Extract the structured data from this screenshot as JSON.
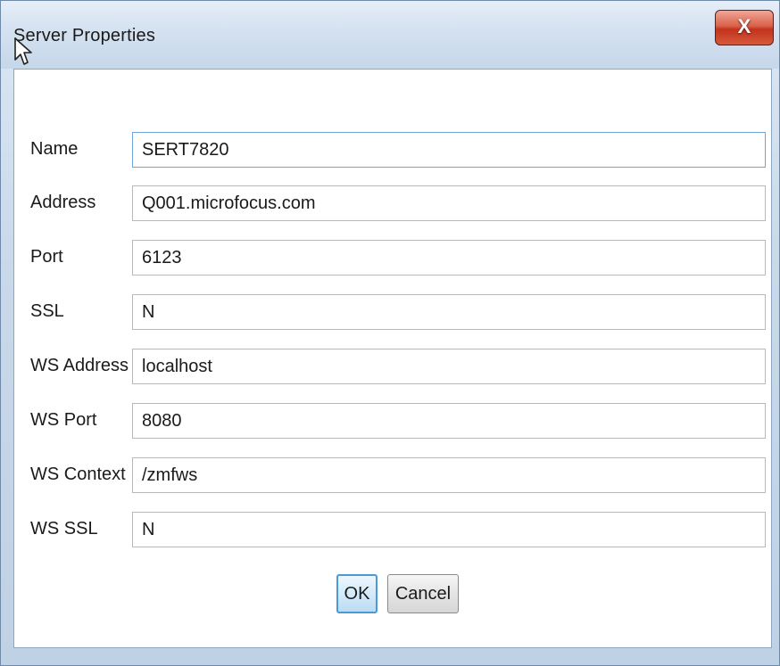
{
  "window": {
    "title": "Server Properties",
    "close_label": "X"
  },
  "form": {
    "fields": [
      {
        "label": "Name",
        "value": "SERT7820"
      },
      {
        "label": "Address",
        "value": "Q001.microfocus.com"
      },
      {
        "label": "Port",
        "value": "6123"
      },
      {
        "label": "SSL",
        "value": "N"
      },
      {
        "label": "WS Address",
        "value": "localhost"
      },
      {
        "label": "WS Port",
        "value": "8080"
      },
      {
        "label": "WS Context",
        "value": "/zmfws"
      },
      {
        "label": "WS SSL",
        "value": "N"
      }
    ]
  },
  "buttons": {
    "ok_label": "OK",
    "cancel_label": "Cancel"
  },
  "colors": {
    "accent": "#4a9ad8",
    "close": "#c2321c"
  }
}
